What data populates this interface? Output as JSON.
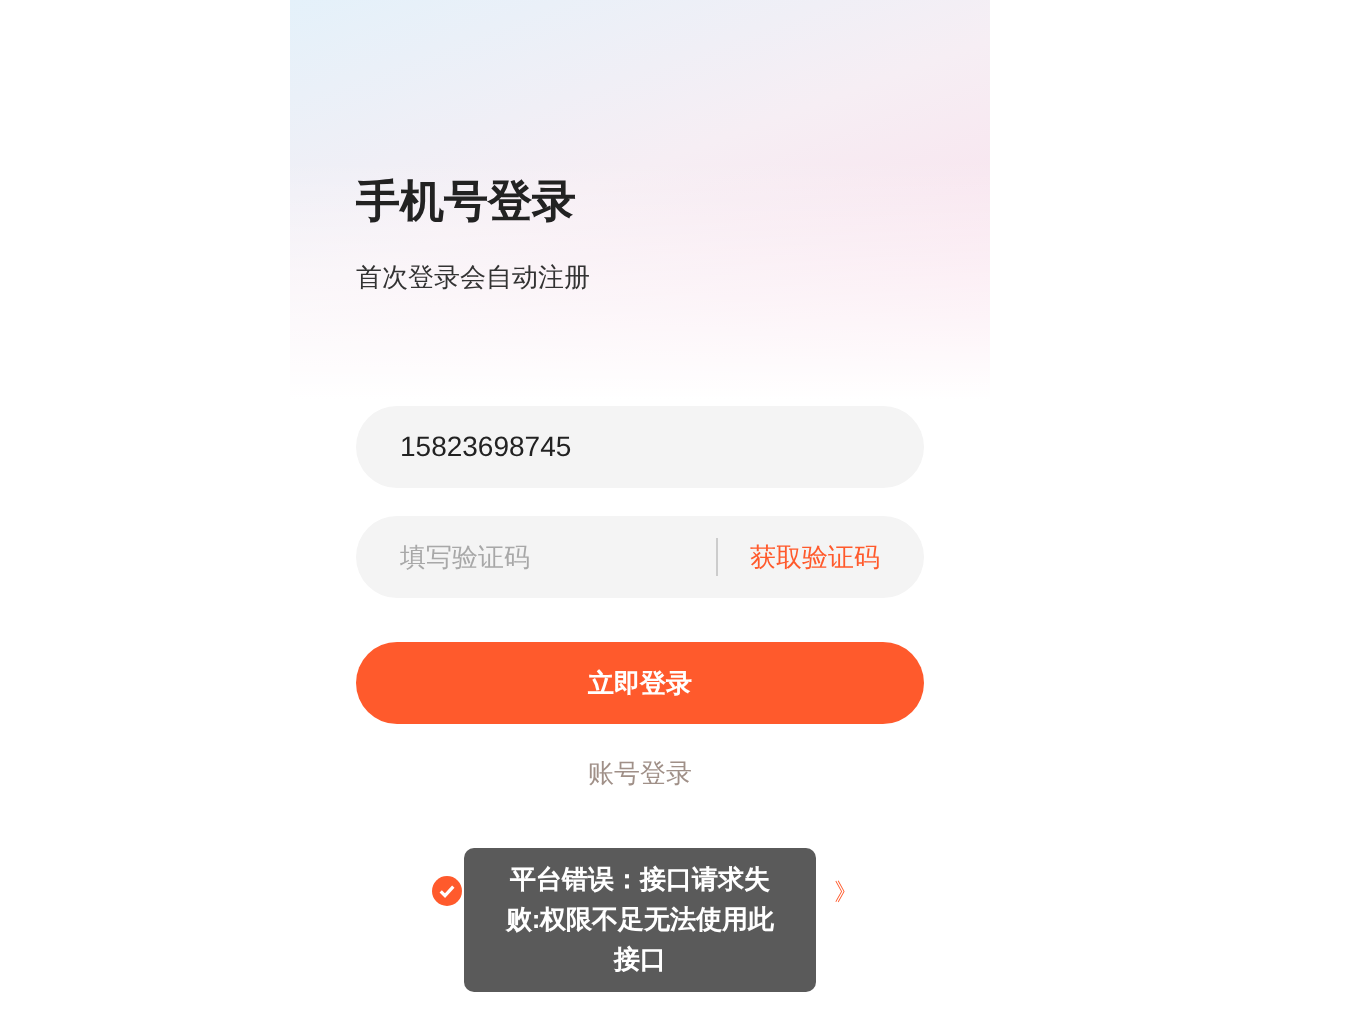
{
  "title": "手机号登录",
  "subtitle": "首次登录会自动注册",
  "phone_field": {
    "value": "15823698745"
  },
  "code_field": {
    "placeholder": "填写验证码",
    "action": "获取验证码"
  },
  "login_button": "立即登录",
  "account_login_link": "账号登录",
  "agreement": {
    "checked": true,
    "suffix": "》"
  },
  "toast": "平台错误：接口请求失败:权限不足无法使用此接口"
}
